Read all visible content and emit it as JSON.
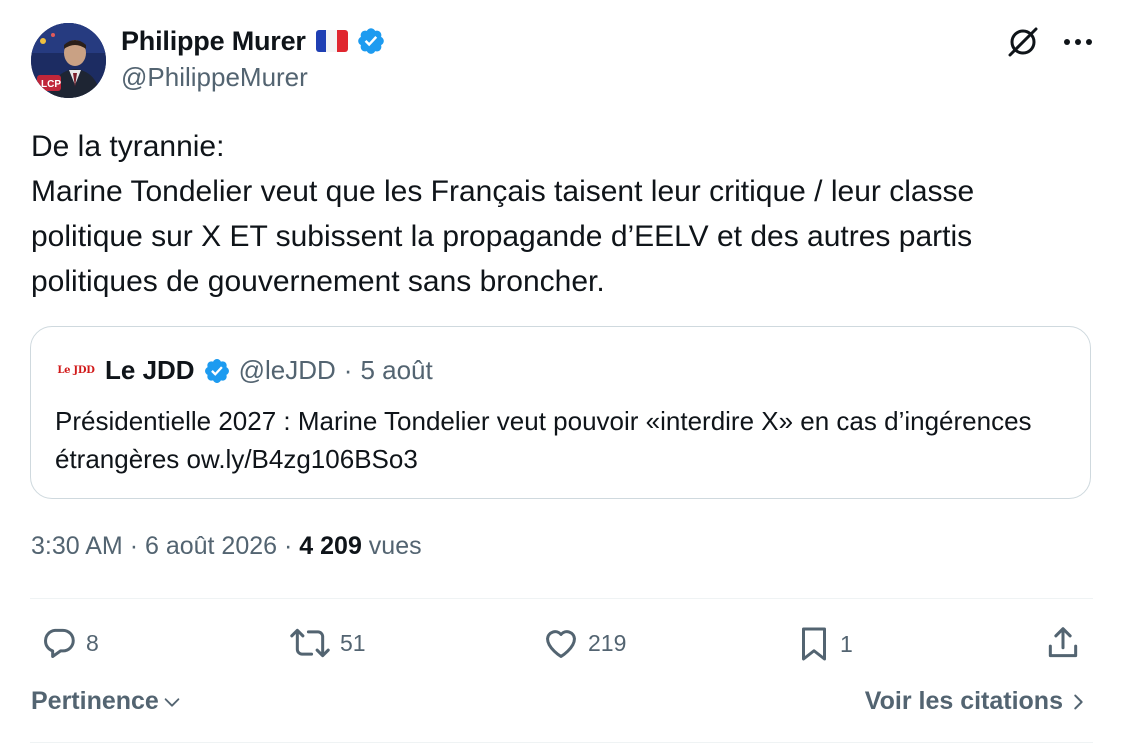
{
  "author": {
    "display_name": "Philippe Murer",
    "handle": "@PhilippeMurer",
    "flag": "🇫🇷",
    "verified": true
  },
  "tweet": {
    "text": "De la tyrannie:\nMarine Tondelier veut que les Français taisent leur critique / leur classe politique sur X ET subissent la propagande d’EELV et des autres partis politiques de gouvernement sans broncher."
  },
  "quote": {
    "logo_text": "Le JDD",
    "display_name": "Le JDD",
    "handle": "@leJDD",
    "separator": "·",
    "date": "5 août",
    "text": "Présidentielle 2027 : Marine Tondelier veut pouvoir «interdire X» en cas d’ingérences étrangères ow.ly/B4zg106BSo3"
  },
  "meta": {
    "time": "3:30 AM",
    "separator": "·",
    "date": "6 août 2026",
    "views_count": "4 209",
    "views_label": "vues"
  },
  "actions": {
    "replies": "8",
    "reposts": "51",
    "likes": "219",
    "bookmarks": "1"
  },
  "footer": {
    "sort_label": "Pertinence",
    "quotes_label": "Voir les citations"
  },
  "colors": {
    "text": "#0f1419",
    "secondary": "#536471",
    "verified": "#1d9bf0",
    "border": "#cfd9de",
    "jdd_red": "#d11a1a"
  }
}
